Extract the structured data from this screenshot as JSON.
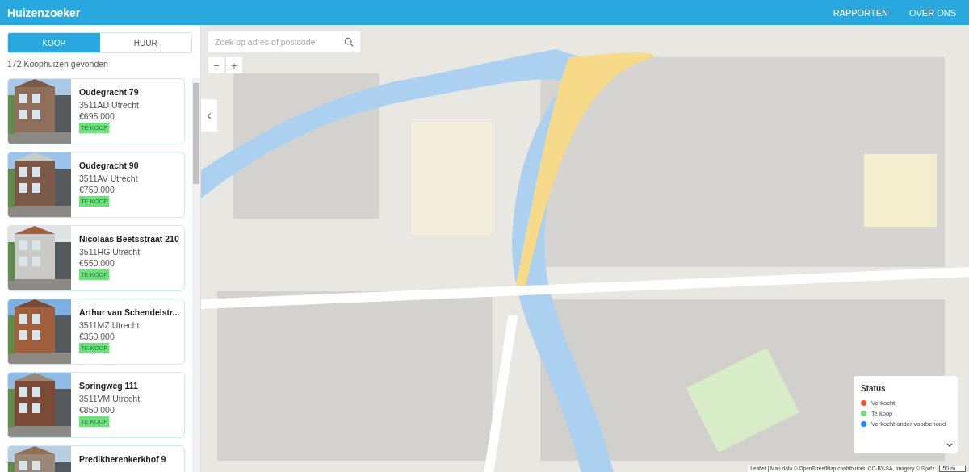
{
  "header": {
    "logo": "Huizenzoeker",
    "nav": [
      {
        "label": "RAPPORTEN"
      },
      {
        "label": "OVER ONS"
      }
    ]
  },
  "tabs": [
    {
      "label": "KOOP",
      "selected": true
    },
    {
      "label": "HUUR",
      "selected": false
    }
  ],
  "result_count": "172 Koophuizen gevonden",
  "listings": [
    {
      "title": "Oudegracht 79",
      "city": "3511AD Utrecht",
      "price": "€695.000",
      "status": "TE KOOP",
      "color": "#6ee07e"
    },
    {
      "title": "Oudegracht 90",
      "city": "3511AV Utrecht",
      "price": "€750.000",
      "status": "TE KOOP",
      "color": "#6ee07e"
    },
    {
      "title": "Nicolaas Beetsstraat 210",
      "city": "3511HG Utrecht",
      "price": "€550.000",
      "status": "TE KOOP",
      "color": "#6ee07e"
    },
    {
      "title": "Arthur van Schendelstr...",
      "city": "3511MZ Utrecht",
      "price": "€350.000",
      "status": "TE KOOP",
      "color": "#6ee07e"
    },
    {
      "title": "Springweg 111",
      "city": "3511VM Utrecht",
      "price": "€850.000",
      "status": "TE KOOP",
      "color": "#6ee07e"
    },
    {
      "title": "Predikherenkerkhof 9"
    }
  ],
  "map": {
    "search": {
      "placeholder": "Zoek op adres of postcode"
    },
    "zoom_out": "−",
    "zoom_in": "+",
    "collapse": "‹",
    "legend": {
      "title": "Status",
      "items": [
        {
          "label": "Verkocht",
          "color": "#f0582f"
        },
        {
          "label": "Te koop",
          "color": "#6ee07e"
        },
        {
          "label": "Verkocht onder voorbehoud",
          "color": "#1e90f0"
        }
      ]
    },
    "attribution": "Leaflet | Map data © OpenStreetMap contributors, CC-BY-SA, Imagery © Spotz",
    "scale": "50 m"
  }
}
